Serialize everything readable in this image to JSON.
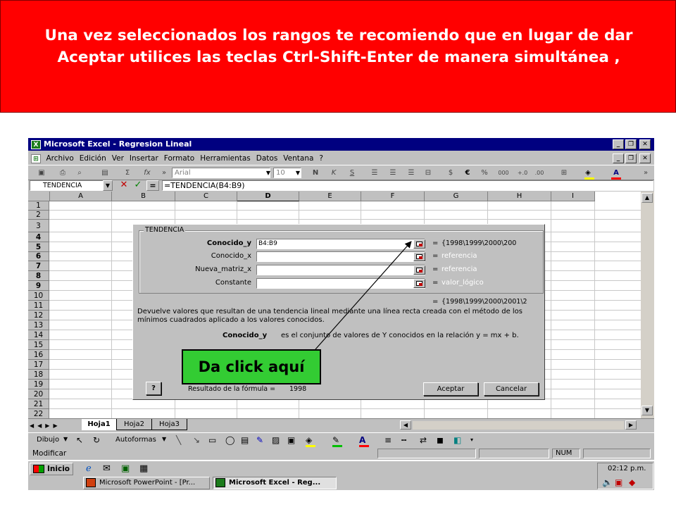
{
  "banner": {
    "text": "Una vez seleccionados los rangos te recomiendo que en lugar de dar Aceptar utilices las teclas Ctrl-Shift-Enter de manera simultánea ,"
  },
  "window": {
    "title": "Microsoft Excel - Regresion Lineal"
  },
  "menu": {
    "items": [
      "Archivo",
      "Edición",
      "Ver",
      "Insertar",
      "Formato",
      "Herramientas",
      "Datos",
      "Ventana",
      "?"
    ]
  },
  "toolbar": {
    "font_name": "Arial",
    "font_size": "10",
    "bold": "N",
    "italic": "K",
    "underline": "S",
    "currency": "€",
    "percent": "%",
    "thousands": "000"
  },
  "formula_bar": {
    "name_box": "TENDENCIA",
    "equals": "=",
    "formula": "=TENDENCIA(B4:B9)"
  },
  "columns": [
    "A",
    "B",
    "C",
    "D",
    "E",
    "F",
    "G",
    "H",
    "I"
  ],
  "rows": [
    "1",
    "2",
    "3",
    "4",
    "5",
    "6",
    "7",
    "8",
    "9",
    "10",
    "11",
    "12",
    "13",
    "14",
    "15",
    "16",
    "17",
    "18",
    "19",
    "20",
    "21",
    "22"
  ],
  "dialog": {
    "title": "TENDENCIA",
    "args": [
      {
        "label": "Conocido_y",
        "value": "B4:B9",
        "result": "{1998\\1999\\2000\\200"
      },
      {
        "label": "Conocido_x",
        "value": "",
        "result": "referencia"
      },
      {
        "label": "Nueva_matriz_x",
        "value": "",
        "result": "referencia"
      },
      {
        "label": "Constante",
        "value": "",
        "result": "valor_lógico"
      }
    ],
    "equals": "=",
    "total_result": "{1998\\1999\\2000\\2001\\2",
    "description": "Devuelve valores que resultan de una tendencia lineal mediante una línea recta creada con el método de los mínimos cuadrados aplicado a los valores conocidos.",
    "arg_name": "Conocido_y",
    "arg_help": "es el conjunto de valores de Y conocidos en  la relación y = mx + b.",
    "help_icon": "?",
    "formula_result_label": "Resultado de la fórmula =",
    "formula_result_value": "1998",
    "ok_label": "Aceptar",
    "cancel_label": "Cancelar"
  },
  "callout": {
    "text": "Da click aquí"
  },
  "sheets": [
    "Hoja1",
    "Hoja2",
    "Hoja3"
  ],
  "draw_toolbar": {
    "dibujo": "Dibujo",
    "autoformas": "Autoformas"
  },
  "status": {
    "mode": "Modificar",
    "num": "NUM"
  },
  "taskbar": {
    "start": "Inicio",
    "time": "02:12 p.m.",
    "tasks": [
      "Microsoft PowerPoint - [Pr...",
      "Microsoft Excel - Reg..."
    ]
  },
  "colors": {
    "banner_bg": "#ff0000",
    "callout_bg": "#33cc33",
    "titlebar": "#000080"
  }
}
